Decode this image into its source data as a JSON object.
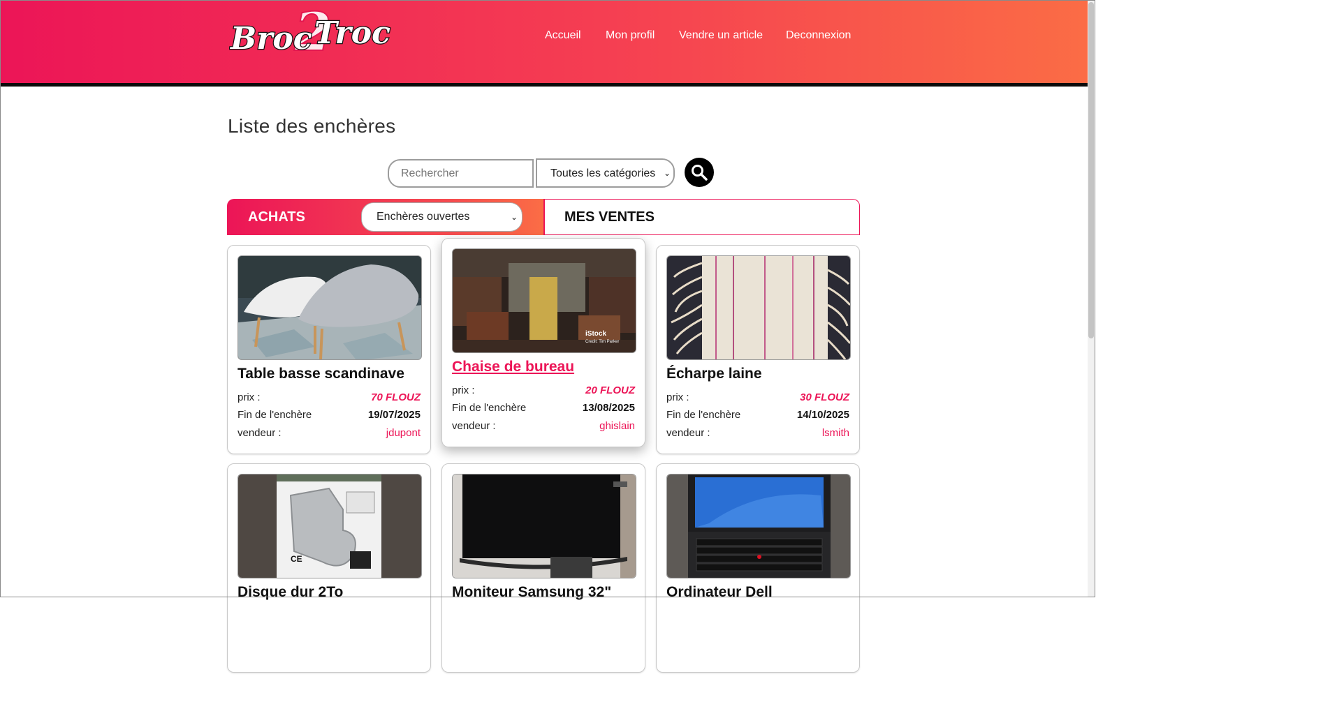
{
  "header": {
    "logo_text": "Broc2Troc",
    "nav": [
      "Accueil",
      "Mon profil",
      "Vendre un article",
      "Deconnexion"
    ]
  },
  "page_title": "Liste des enchères",
  "search": {
    "placeholder": "Rechercher",
    "category_selected": "Toutes les catégories",
    "button_icon": "search-icon"
  },
  "tabs": {
    "achats_label": "ACHATS",
    "achats_filter_selected": "Enchères ouvertes",
    "ventes_label": "MES VENTES"
  },
  "labels": {
    "price": "prix :",
    "end": "Fin de l'enchère",
    "seller": "vendeur :"
  },
  "auctions": [
    {
      "title": "Table basse scandinave",
      "price": "70 FLOUZ",
      "end_date": "19/07/2025",
      "seller": "jdupont"
    },
    {
      "title": "Chaise de bureau",
      "price": "20 FLOUZ",
      "end_date": "13/08/2025",
      "seller": "ghislain",
      "image_watermark": "iStock",
      "image_credit": "Credit: Tim Parker"
    },
    {
      "title": "Écharpe laine",
      "price": "30 FLOUZ",
      "end_date": "14/10/2025",
      "seller": "lsmith"
    },
    {
      "title": "Disque dur 2To"
    },
    {
      "title": "Moniteur Samsung 32\""
    },
    {
      "title": "Ordinateur Dell"
    }
  ],
  "colors": {
    "accent": "#ec1557",
    "accent_end": "#fb6d45",
    "header_border": "#0b0b0b"
  }
}
